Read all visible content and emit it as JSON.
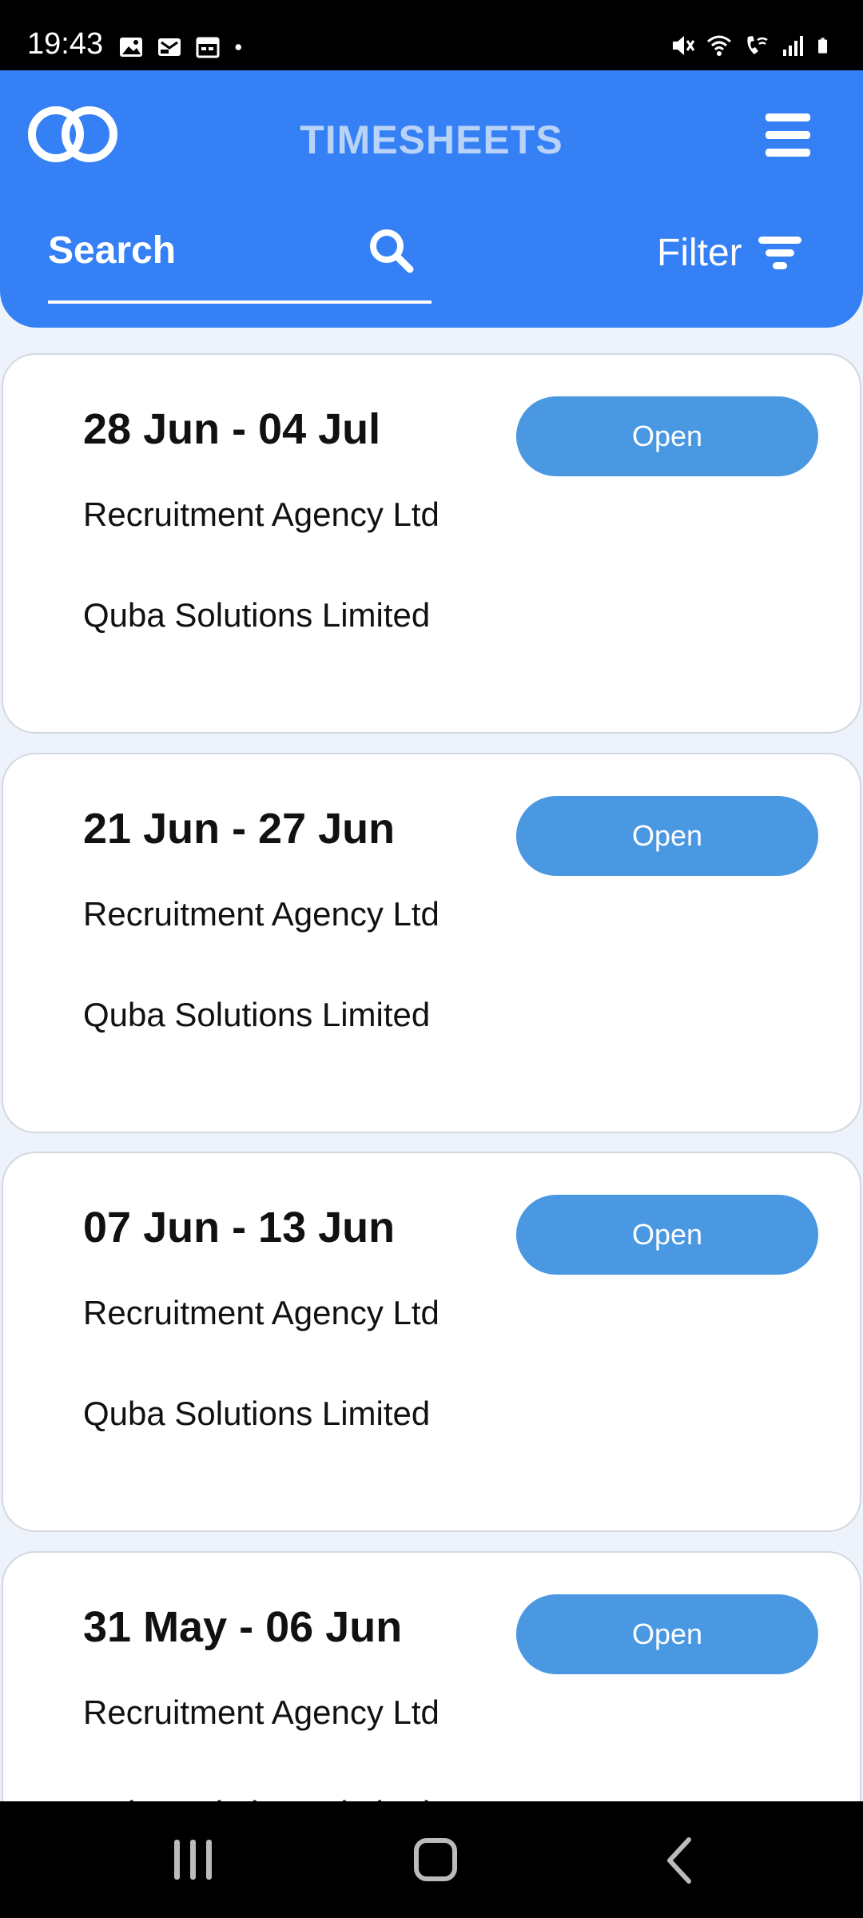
{
  "status_bar": {
    "time": "19:43",
    "left_icons": [
      "image-icon",
      "message-icon",
      "calendar-icon",
      "dot-icon"
    ],
    "right_icons": [
      "mute-icon",
      "wifi-icon",
      "wifi-call-icon",
      "signal-icon",
      "battery-icon"
    ]
  },
  "header": {
    "title": "TIMESHEETS",
    "search_label": "Search",
    "filter_label": "Filter",
    "background_color": "#3580f5"
  },
  "timesheets": [
    {
      "date_range": "28 Jun - 04 Jul",
      "agency": "Recruitment Agency Ltd",
      "client": "Quba Solutions Limited",
      "button_label": "Open"
    },
    {
      "date_range": "21 Jun - 27 Jun",
      "agency": "Recruitment Agency Ltd",
      "client": "Quba Solutions Limited",
      "button_label": "Open"
    },
    {
      "date_range": "07 Jun - 13 Jun",
      "agency": "Recruitment Agency Ltd",
      "client": "Quba Solutions Limited",
      "button_label": "Open"
    },
    {
      "date_range": "31 May - 06 Jun",
      "agency": "Recruitment Agency Ltd",
      "client": "Quba Solutions Limited",
      "button_label": "Open"
    }
  ],
  "colors": {
    "accent": "#3580f5",
    "button": "#4a98e2",
    "title": "#b9d2f8"
  }
}
